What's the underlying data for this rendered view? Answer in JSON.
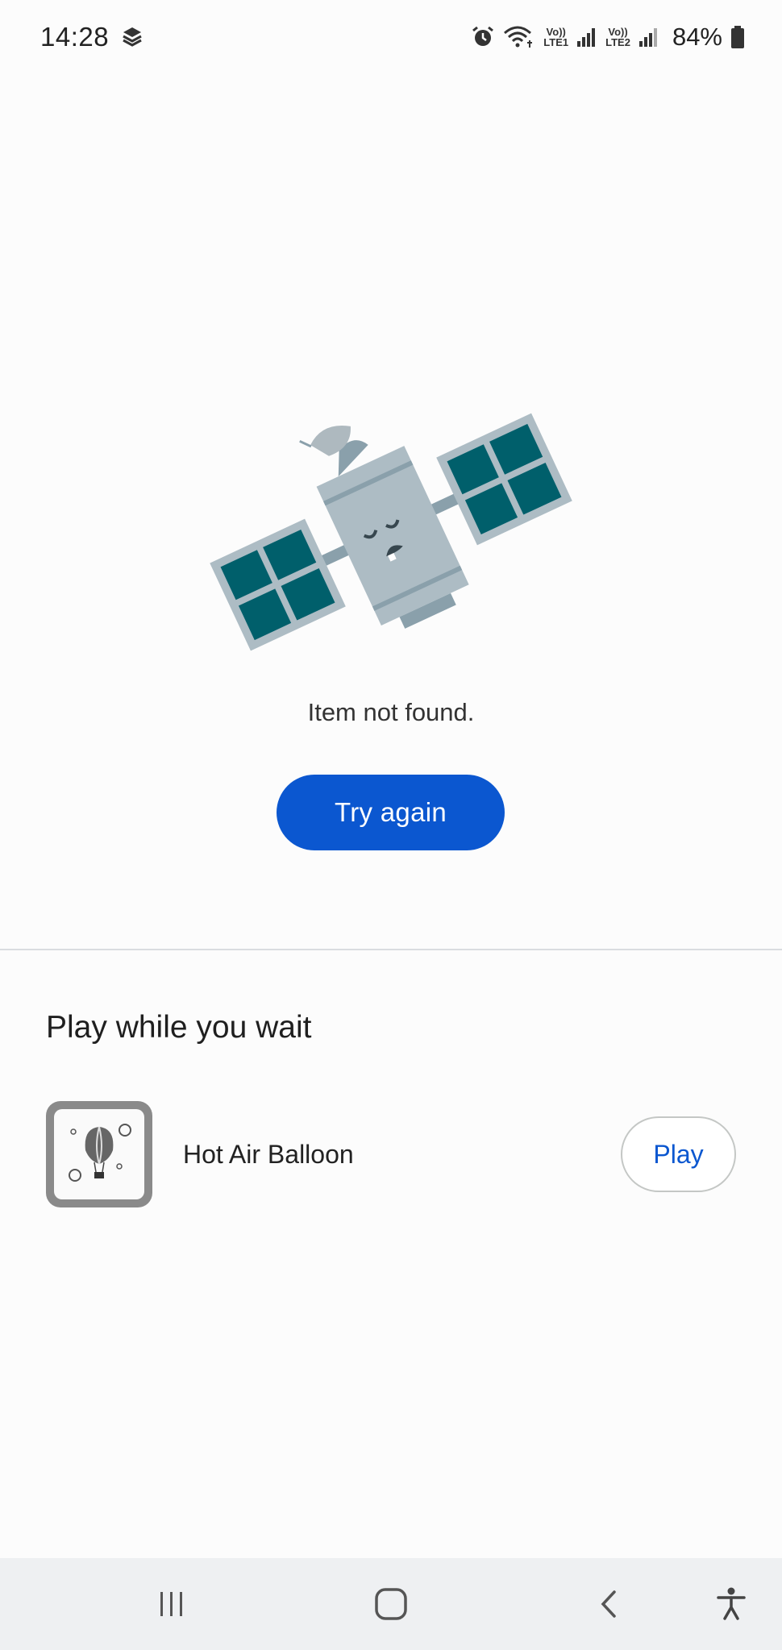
{
  "status_bar": {
    "time": "14:28",
    "lte1": "LTE1",
    "lte2": "LTE2",
    "volte": "Vo))",
    "battery": "84%",
    "icons": [
      "app-notification-icon",
      "alarm-icon",
      "wifi-icon",
      "signal-icon",
      "battery-icon"
    ]
  },
  "error": {
    "illustration": "satellite-illustration",
    "message": "Item not found.",
    "retry_label": "Try again"
  },
  "games": {
    "section_title": "Play while you wait",
    "items": [
      {
        "name": "Hot Air Balloon",
        "icon": "hot-air-balloon-game-icon",
        "action_label": "Play"
      }
    ]
  },
  "nav_bar": {
    "buttons": [
      "recent-apps-icon",
      "home-icon",
      "back-icon",
      "accessibility-icon"
    ]
  },
  "colors": {
    "accent": "#0b57d0",
    "satellite_panel": "#005f6b",
    "satellite_body": "#adbcc4"
  }
}
